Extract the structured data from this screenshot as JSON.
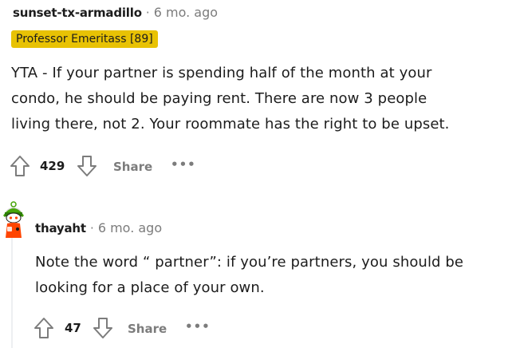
{
  "comments": [
    {
      "username": "sunset-tx-armadillo",
      "separator": "·",
      "time": "6 mo. ago",
      "flair": "Professor Emeritass [89]",
      "body": [
        "YTA - If your partner is spending half of the month at your",
        "condo, he should be paying rent. There are now 3 people",
        "living there, not 2. Your roommate has the right to be upset."
      ],
      "votes": "429",
      "share_label": "Share",
      "more_label": "•••"
    },
    {
      "username": "thayaht",
      "separator": "·",
      "time": "6 mo. ago",
      "body": [
        "Note the word “ partner”: if you’re partners, you should be",
        "looking for a place of your own."
      ],
      "votes": "47",
      "share_label": "Share",
      "more_label": "•••"
    }
  ],
  "colors": {
    "flair_bg": "#e8c204",
    "meta_gray": "#7c7c7c",
    "text": "#1c1c1c"
  },
  "icons": [
    "upvote-icon",
    "downvote-icon",
    "avatar"
  ]
}
